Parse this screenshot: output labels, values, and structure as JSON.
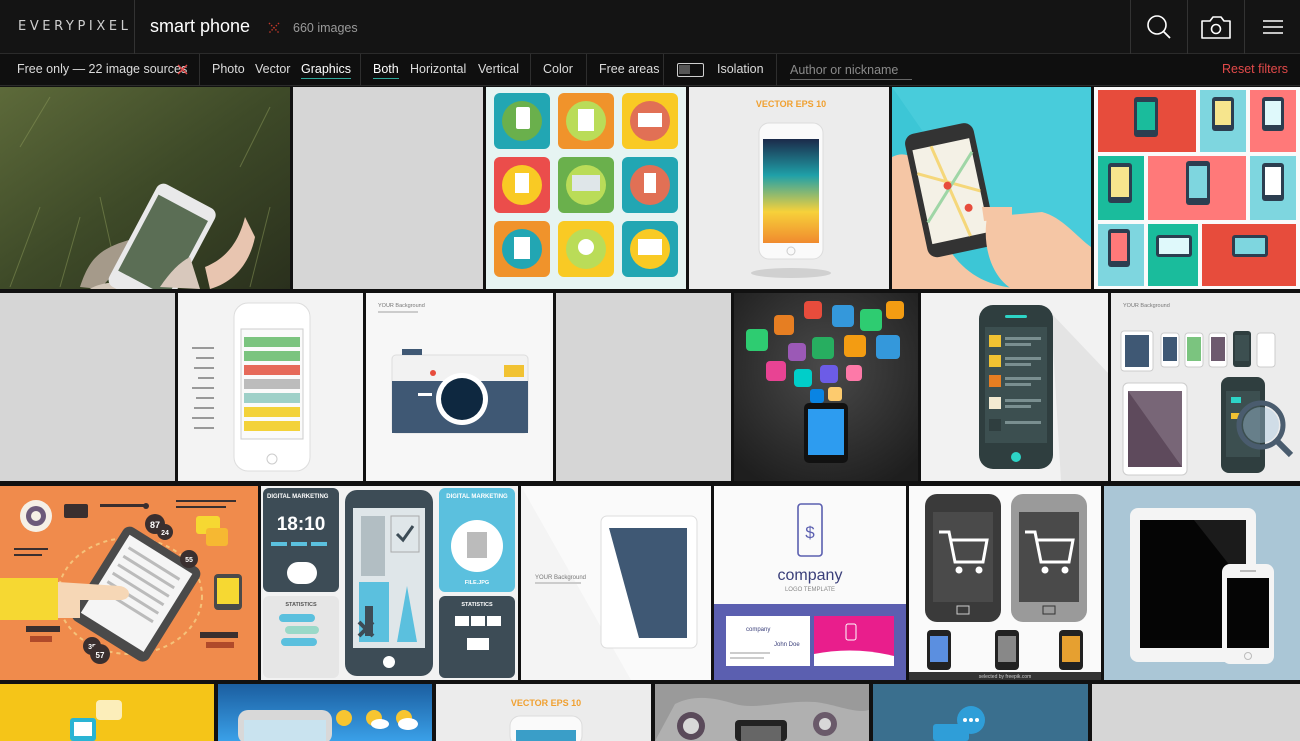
{
  "header": {
    "logo": "EVERYPIXEL",
    "query": "smart phone",
    "image_count": "660 images",
    "icons": [
      "search-icon",
      "camera-icon",
      "menu-icon"
    ]
  },
  "filters": {
    "free_only": "Free only — 22 image sources",
    "type_options": [
      "Photo",
      "Vector",
      "Graphics"
    ],
    "type_selected": "Graphics",
    "orientation_options": [
      "Both",
      "Horizontal",
      "Vertical"
    ],
    "orientation_selected": "Both",
    "color": "Color",
    "free_areas": "Free areas",
    "isolation": "Isolation",
    "author_placeholder": "Author or nickname",
    "reset": "Reset filters"
  },
  "tiles": {
    "t5_text": "VECTOR EPS 10",
    "t9_text": "YOUR Background",
    "t13_text": "YOUR Background",
    "t15_digital": "DIGITAL MARKETING",
    "t15_time": "18:10",
    "t15_stats": "STATISTICS",
    "t15_digital2": "DIGITAL MARKETING",
    "t15_file": "FILE.JPG",
    "t15_stats2": "STATISTICS",
    "t16_text": "YOUR Background",
    "t17_company": "company",
    "t17_sub": "LOGO TEMPLATE",
    "t17_card": "company",
    "t17_name": "John Doe",
    "t18_caption": "selected by freepik.com",
    "t21_text": "VECTOR EPS 10",
    "t14_numbers": [
      "87",
      "24",
      "55",
      "35",
      "57"
    ]
  },
  "colors": {
    "accent": "#2fa99c",
    "reset": "#e24a4a",
    "background": "#141414"
  }
}
